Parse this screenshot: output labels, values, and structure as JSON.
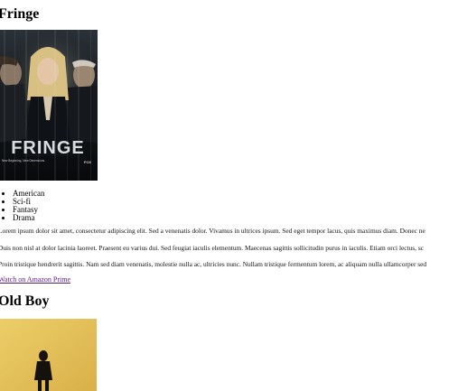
{
  "movies": [
    {
      "title": "Fringe",
      "poster": {
        "wordmark": "FRINGE",
        "tagline": "New Beginning. New Dimensions.",
        "network": "FOX"
      },
      "genres": [
        "American",
        "Sci-fi",
        "Fantasy",
        "Drama"
      ],
      "description_lines": [
        "Lorem ipsum dolor sit amet, consectetur adipiscing elit. Sed a venenatis dolor. Vivamus in ultrices ipsum. Sed eget tempor lacus, quis maximus diam. Donec ne",
        "Duis non nisl at dolor lacinia laoreet. Praesent eu varius dui. Sed feugiat iaculis elementum. Maecenas sagittis sollicitudin purus in iaculis. Etiam orci lectus, sc",
        "Proin tristique hendrerit sagittis. Nam sed diam venenatis, molestie nulla ac, ultricies nunc. Nullam tristique fermentum lorem, ac aliquam nulla ullamcorper sed"
      ],
      "link_label": "Watch on Amazon Prime"
    },
    {
      "title": "Old Boy"
    }
  ],
  "colors": {
    "link": "#551a8b",
    "oldboy_poster_bg": "#e3bf57"
  }
}
